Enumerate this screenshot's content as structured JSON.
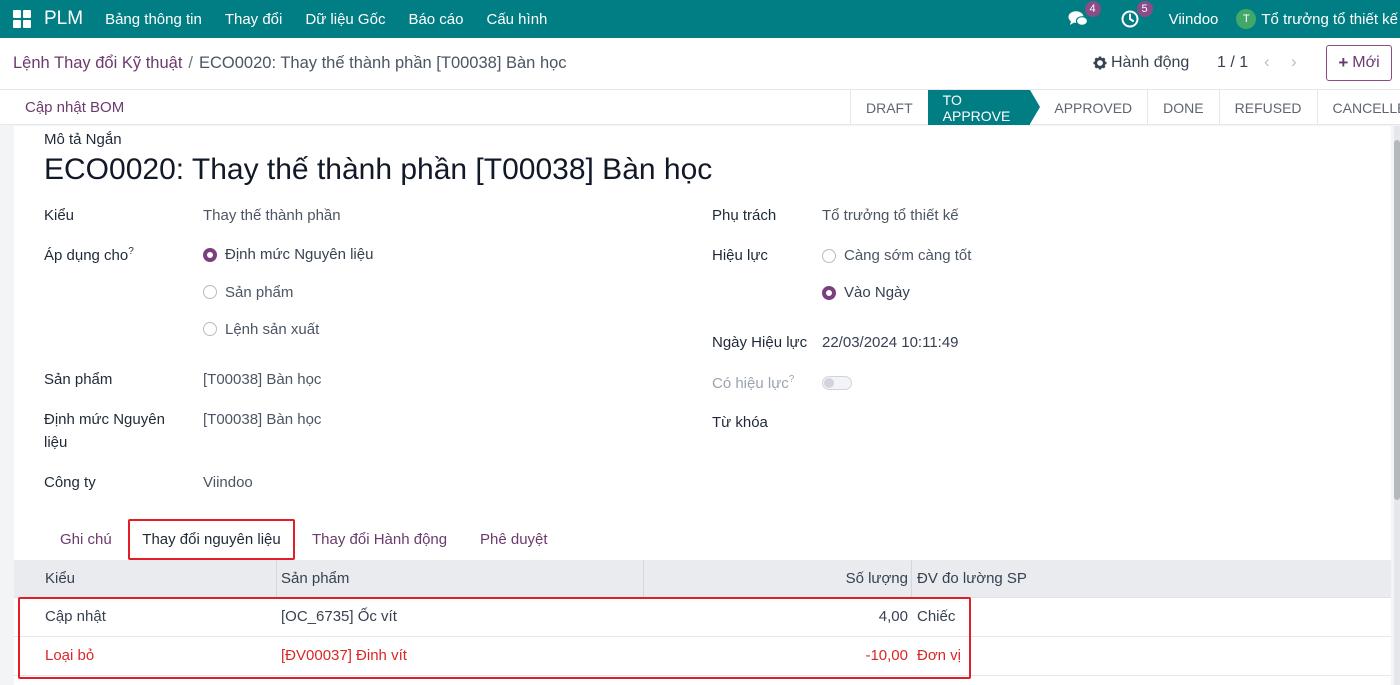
{
  "navbar": {
    "brand": "PLM",
    "menu": [
      "Bảng thông tin",
      "Thay đổi",
      "Dữ liệu Gốc",
      "Báo cáo",
      "Cấu hình"
    ],
    "messages_count": "4",
    "activities_count": "5",
    "company": "Viindoo",
    "user_initial": "T",
    "user_name": "Tổ trưởng tổ thiết kế"
  },
  "control": {
    "breadcrumb_parent": "Lệnh Thay đổi Kỹ thuật",
    "breadcrumb_sep": "/",
    "breadcrumb_current": "ECO0020: Thay thế thành phần [T00038] Bàn học",
    "action_label": "Hành động",
    "pager": "1 / 1",
    "new_label": "Mới"
  },
  "statusbar": {
    "update_bom": "Cập nhật BOM",
    "stages": [
      "DRAFT",
      "TO APPROVE",
      "APPROVED",
      "DONE",
      "REFUSED",
      "CANCELLED"
    ],
    "active_stage": "TO APPROVE"
  },
  "form": {
    "short_desc_label": "Mô tả Ngắn",
    "title": "ECO0020: Thay thế thành phần [T00038] Bàn học",
    "type_label": "Kiểu",
    "type_value": "Thay thế thành phần",
    "apply_label": "Áp dụng cho",
    "apply_options": [
      "Định mức Nguyên liệu",
      "Sản phẩm",
      "Lệnh sản xuất"
    ],
    "apply_selected": "Định mức Nguyên liệu",
    "product_label": "Sản phẩm",
    "product_value": "[T00038] Bàn học",
    "bom_label_line1": "Định mức Nguyên",
    "bom_label_line2": "liệu",
    "bom_value": "[T00038] Bàn học",
    "company_label": "Công ty",
    "company_value": "Viindoo",
    "responsible_label": "Phụ trách",
    "responsible_value": "Tổ trưởng tổ thiết kế",
    "effective_label": "Hiệu lực",
    "effective_options": [
      "Càng sớm càng tốt",
      "Vào Ngày"
    ],
    "effective_selected": "Vào Ngày",
    "effective_date_label": "Ngày Hiệu lực",
    "effective_date_value": "22/03/2024 10:11:49",
    "is_effective_label": "Có hiệu lực",
    "is_effective_on": false,
    "tags_label": "Từ khóa",
    "help_mark": "?"
  },
  "tabs": {
    "items": [
      "Ghi chú",
      "Thay đổi nguyên liệu",
      "Thay đổi Hành động",
      "Phê duyệt"
    ],
    "active": "Thay đổi nguyên liệu"
  },
  "table": {
    "columns": [
      "Kiểu",
      "Sản phẩm",
      "Số lượng",
      "ĐV đo lường SP"
    ],
    "rows": [
      {
        "type": "Cập nhật",
        "product": "[OC_6735] Ốc vít",
        "qty": "4,00",
        "uom": "Chiếc",
        "removed": false
      },
      {
        "type": "Loại bỏ",
        "product": "[ĐV00037] Đinh vít",
        "qty": "-10,00",
        "uom": "Đơn vị",
        "removed": true
      }
    ]
  }
}
